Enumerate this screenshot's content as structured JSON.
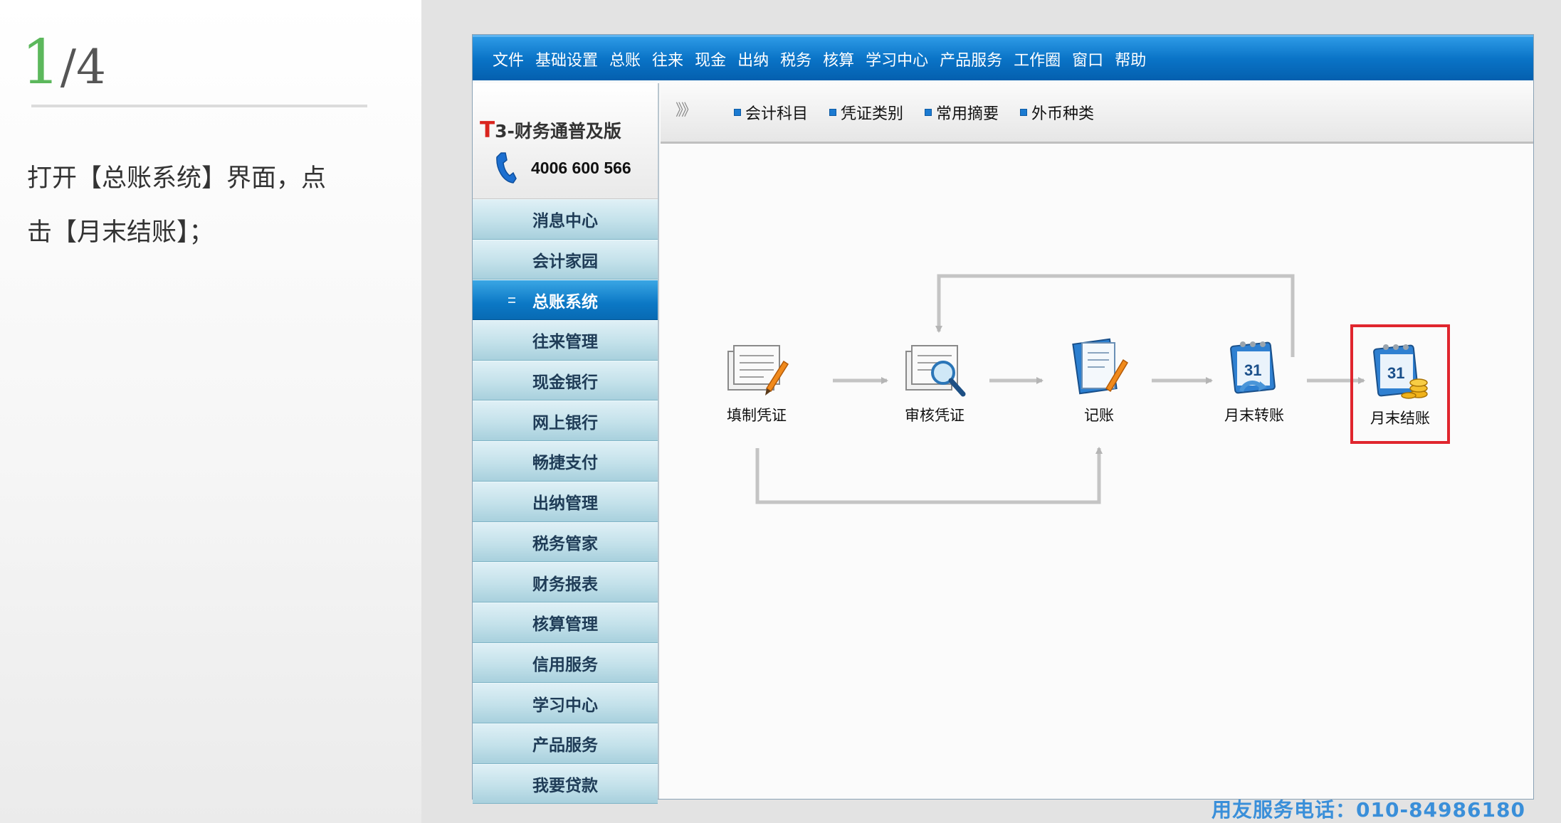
{
  "step": {
    "current": "1",
    "total": "/4"
  },
  "instruction": {
    "line1": "打开【总账系统】界面，点",
    "line2": "击【月末结账】；"
  },
  "menu": [
    "文件",
    "基础设置",
    "总账",
    "往来",
    "现金",
    "出纳",
    "税务",
    "核算",
    "学习中心",
    "产品服务",
    "工作圈",
    "窗口",
    "帮助"
  ],
  "brand": {
    "t": "T",
    "name": "3-财务通普及版",
    "phone": "4006 600 566"
  },
  "nav": [
    "消息中心",
    "会计家园",
    "总账系统",
    "往来管理",
    "现金银行",
    "网上银行",
    "畅捷支付",
    "出纳管理",
    "税务管家",
    "财务报表",
    "核算管理",
    "信用服务",
    "学习中心",
    "产品服务",
    "我要贷款"
  ],
  "nav_active_index": 2,
  "toolbar": {
    "expand": "》》",
    "links": [
      "会计科目",
      "凭证类别",
      "常用摘要",
      "外币种类"
    ]
  },
  "flow": [
    "填制凭证",
    "审核凭证",
    "记账",
    "月末转账",
    "月末结账"
  ],
  "highlighted_flow_item": "月末结账",
  "footer_phone": "用友服务电话：010-84986180",
  "colors": {
    "menu_bar": "#0a74c7",
    "nav_active": "#0b78c5",
    "highlight_box": "#e0262e",
    "step_green": "#5cb85c",
    "footer_text": "#3a8fd9"
  },
  "icons": [
    "phone-icon",
    "voucher-edit-icon",
    "voucher-audit-icon",
    "ledger-post-icon",
    "month-transfer-icon",
    "month-close-icon"
  ]
}
